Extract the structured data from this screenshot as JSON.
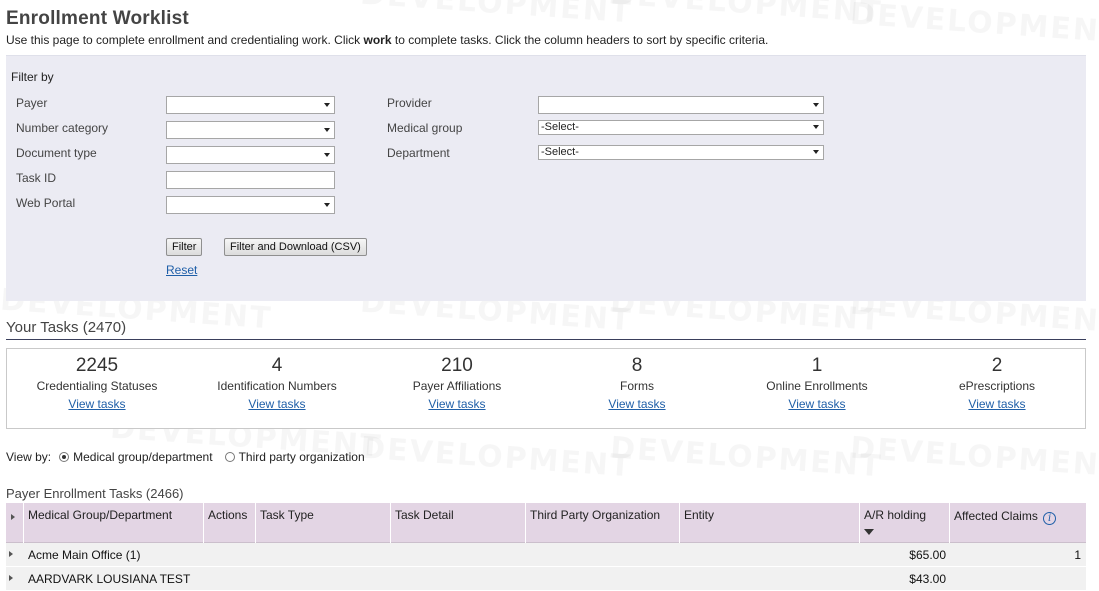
{
  "page": {
    "title": "Enrollment Worklist",
    "intro_before": "Use this page to complete enrollment and credentialing work. Click ",
    "intro_bold": "work",
    "intro_after": " to complete tasks. Click the column headers to sort by specific criteria."
  },
  "watermark": "DEVELOPMENT",
  "filter": {
    "heading": "Filter by",
    "left_fields": {
      "payer": {
        "label": "Payer",
        "value": ""
      },
      "number_category": {
        "label": "Number category",
        "value": ""
      },
      "document_type": {
        "label": "Document type",
        "value": ""
      },
      "task_id": {
        "label": "Task ID",
        "value": ""
      },
      "web_portal": {
        "label": "Web Portal",
        "value": ""
      }
    },
    "right_fields": {
      "provider": {
        "label": "Provider",
        "value": ""
      },
      "medical_group": {
        "label": "Medical group",
        "value": "-Select-"
      },
      "department": {
        "label": "Department",
        "value": "-Select-"
      }
    },
    "filter_button": "Filter",
    "download_button": "Filter and Download (CSV)",
    "reset_link": "Reset"
  },
  "your_tasks": {
    "title": "Your Tasks (2470)",
    "link_label": "View tasks",
    "tiles": [
      {
        "count": "2245",
        "label": "Credentialing Statuses"
      },
      {
        "count": "4",
        "label": "Identification Numbers"
      },
      {
        "count": "210",
        "label": "Payer Affiliations"
      },
      {
        "count": "8",
        "label": "Forms"
      },
      {
        "count": "1",
        "label": "Online Enrollments"
      },
      {
        "count": "2",
        "label": "ePrescriptions"
      }
    ]
  },
  "view_by": {
    "label": "View by:",
    "options": [
      "Medical group/department",
      "Third party organization"
    ],
    "selected": "Medical group/department"
  },
  "payer_enrollment": {
    "title": "Payer Enrollment Tasks (2466)",
    "columns": {
      "medical_group": "Medical Group/Department",
      "actions": "Actions",
      "task_type": "Task Type",
      "task_detail": "Task Detail",
      "third_party": "Third Party Organization",
      "entity": "Entity",
      "ar_holding": "A/R holding",
      "affected_claims": "Affected Claims"
    },
    "rows": [
      {
        "name": "Acme Main Office (1)",
        "ar_holding": "$65.00",
        "affected_claims": "1"
      },
      {
        "name": "AARDVARK LOUSIANA TEST",
        "ar_holding": "$43.00",
        "affected_claims": ""
      }
    ]
  },
  "colors": {
    "accent_link": "#1f5fa8",
    "filter_bg": "#ebebf3",
    "table_header_bg": "#e3d5e4",
    "row_bg": "#f1f1f1"
  }
}
